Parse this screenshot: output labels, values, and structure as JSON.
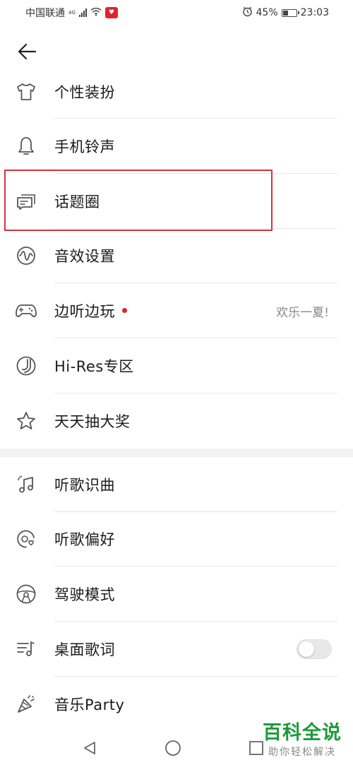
{
  "status": {
    "carrier": "中国联通",
    "network_tag": "4G",
    "battery": "45%",
    "battery_level": 0.45,
    "time": "23:03"
  },
  "menu_group_1": [
    {
      "label": "个性装扮",
      "icon": "tshirt-icon"
    },
    {
      "label": "手机铃声",
      "icon": "bell-icon"
    },
    {
      "label": "话题圈",
      "icon": "chat-bubbles-icon"
    },
    {
      "label": "音效设置",
      "icon": "sound-wave-icon"
    },
    {
      "label": "边听边玩",
      "icon": "gamepad-icon",
      "hint": "欢乐一夏!",
      "has_dot": true
    },
    {
      "label": "Hi-Res专区",
      "icon": "hires-icon"
    },
    {
      "label": "天天抽大奖",
      "icon": "star-icon"
    }
  ],
  "menu_group_2": [
    {
      "label": "听歌识曲",
      "icon": "music-note-icon"
    },
    {
      "label": "听歌偏好",
      "icon": "preference-icon"
    },
    {
      "label": "驾驶模式",
      "icon": "steering-wheel-icon"
    },
    {
      "label": "桌面歌词",
      "icon": "lyrics-icon",
      "toggle_on": false
    },
    {
      "label": "音乐Party",
      "icon": "party-icon"
    }
  ],
  "watermark": {
    "main": "百科全说",
    "sub": "助你轻松解决"
  },
  "colors": {
    "accent_red": "#e0232f",
    "highlight_border": "#d0353f",
    "watermark_green": "#1f9a3a"
  }
}
